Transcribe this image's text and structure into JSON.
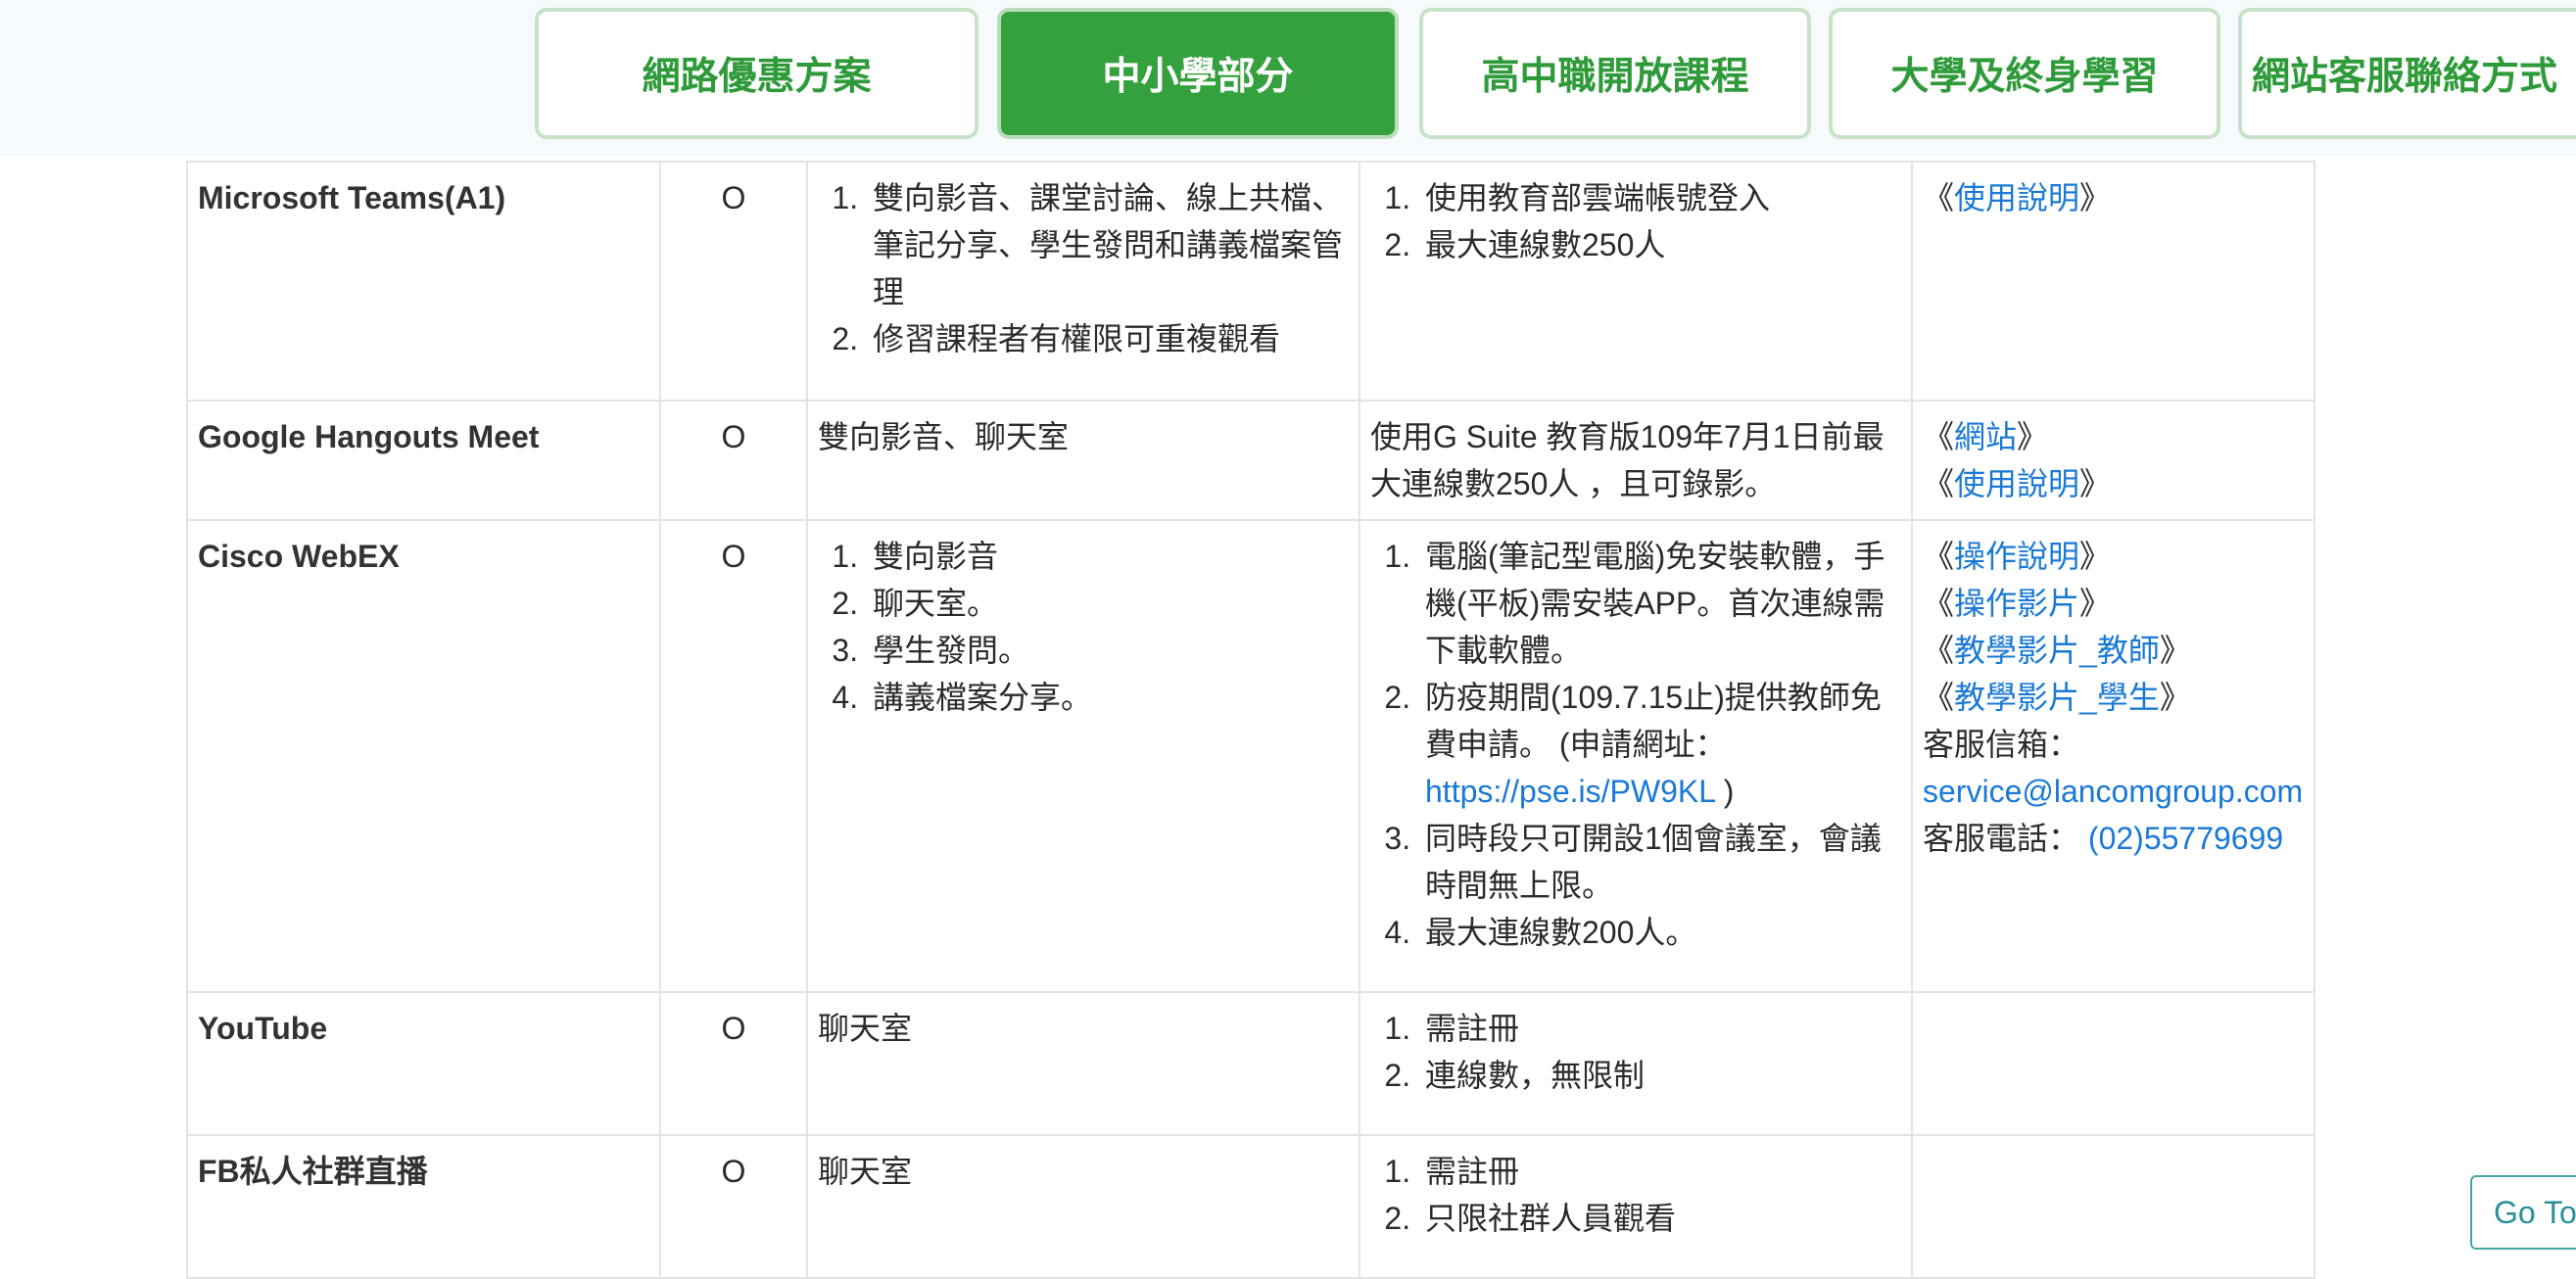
{
  "tabs": [
    {
      "label": "網路優惠方案"
    },
    {
      "label": "中小學部分"
    },
    {
      "label": "高中職開放課程"
    },
    {
      "label": "大學及終身學習"
    },
    {
      "label": "網站客服聯絡方式"
    }
  ],
  "rows": [
    {
      "name": "Microsoft Teams(A1)",
      "mark": "O",
      "features": [
        "雙向影音、課堂討論、線上共檔、筆記分享、學生發問和講義檔案管理",
        "修習課程者有權限可重複觀看"
      ],
      "notes": [
        "使用教育部雲端帳號登入",
        "最大連線數250人"
      ],
      "links": [
        "使用說明"
      ]
    },
    {
      "name": "Google Hangouts Meet",
      "mark": "O",
      "features_text": "雙向影音、聊天室",
      "notes_text": "使用G Suite 教育版109年7月1日前最大連線數250人 ，且可錄影。",
      "links": [
        "網站",
        "使用說明"
      ]
    },
    {
      "name": "Cisco WebEX",
      "mark": "O",
      "features": [
        "雙向影音",
        "聊天室。",
        "學生發問。",
        "講義檔案分享。"
      ],
      "notes": [
        "電腦(筆記型電腦)免安裝軟體，手機(平板)需安裝APP。首次連線需下載軟體。",
        "防疫期間(109.7.15止)提供教師免費申請。 (申請網址：",
        "同時段只可開設1個會議室，會議時間無上限。",
        "最大連線數200人。"
      ],
      "apply_url": "https://pse.is/PW9KL",
      "apply_close": " )",
      "links": [
        "操作說明",
        "操作影片",
        "教學影片_教師",
        "教學影片_學生"
      ],
      "email_label": "客服信箱：",
      "email": "service@lancomgroup.com",
      "phone_label": "客服電話：",
      "phone": "(02)55779699"
    },
    {
      "name": "YouTube",
      "mark": "O",
      "features_text": "聊天室",
      "notes": [
        "需註冊",
        "連線數，無限制"
      ]
    },
    {
      "name": "FB私人社群直播",
      "mark": "O",
      "features_text": "聊天室",
      "notes": [
        "需註冊",
        "只限社群人員觀看"
      ]
    }
  ],
  "link_open": "《",
  "link_close": "》",
  "gotop_label": "Go Top",
  "colors": {
    "accent_green": "#35a13e",
    "link_blue": "#1a79d6"
  }
}
